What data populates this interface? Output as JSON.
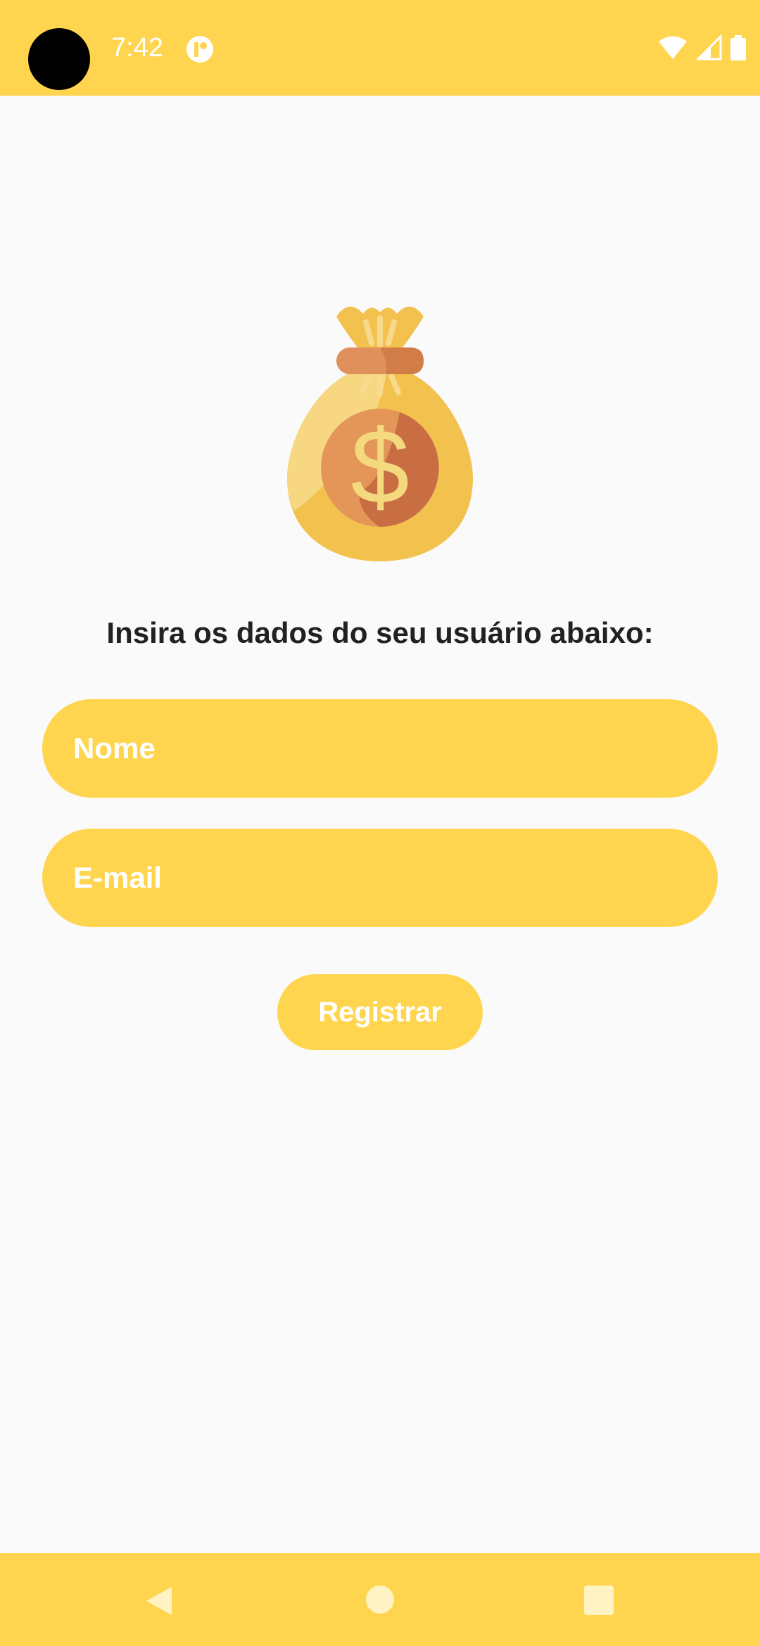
{
  "status_bar": {
    "time": "7:42",
    "icons": [
      "camera-cutout",
      "notification-icon",
      "wifi-icon",
      "signal-icon",
      "battery-icon"
    ]
  },
  "main": {
    "illustration": "money-bag-icon",
    "prompt": "Insira os dados do seu usuário abaixo:",
    "name_field": {
      "placeholder": "Nome",
      "value": ""
    },
    "email_field": {
      "placeholder": "E-mail",
      "value": ""
    },
    "register_label": "Registrar"
  },
  "nav_bar": {
    "icons": [
      "back-icon",
      "home-icon",
      "recents-icon"
    ]
  },
  "colors": {
    "accent": "#ffd54f",
    "background": "#fafafa",
    "text": "#212121",
    "on_accent": "#ffffff"
  }
}
